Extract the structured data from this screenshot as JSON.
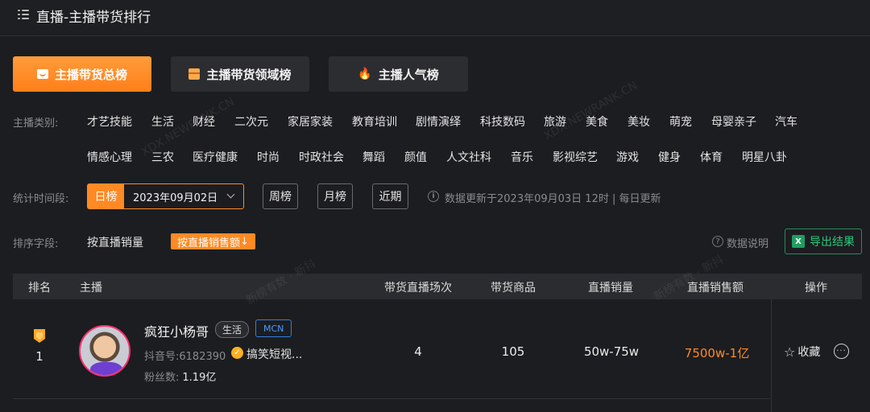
{
  "header": {
    "title": "直播-主播带货排行",
    "menu_icon": "menu-icon"
  },
  "tabs": [
    {
      "label": "主播带货总榜",
      "icon": "mail-icon",
      "active": true
    },
    {
      "label": "主播带货领域榜",
      "icon": "box-icon",
      "active": false
    },
    {
      "label": "主播人气榜",
      "icon": "fire-icon",
      "active": false
    }
  ],
  "filters": {
    "category_label": "主播类别:",
    "categories_row1": [
      "才艺技能",
      "生活",
      "财经",
      "二次元",
      "家居家装",
      "教育培训",
      "剧情演绎",
      "科技数码",
      "旅游",
      "美食",
      "美妆",
      "萌宠",
      "母婴亲子",
      "汽车"
    ],
    "categories_row2": [
      "情感心理",
      "三农",
      "医疗健康",
      "时尚",
      "时政社会",
      "舞蹈",
      "颜值",
      "人文社科",
      "音乐",
      "影视综艺",
      "游戏",
      "健身",
      "体育",
      "明星八卦"
    ],
    "period_label": "统计时间段:",
    "period_day": "日榜",
    "period_date": "2023年09月02日",
    "period_week": "周榜",
    "period_month": "月榜",
    "period_recent": "近期",
    "update_note": "数据更新于2023年09月03日 12时 | 每日更新",
    "sort_label": "排序字段:",
    "sort_options": [
      "按直播销量",
      "按直播销售额"
    ],
    "sort_active_arrow": "↓",
    "data_help": "数据说明",
    "export": "导出结果"
  },
  "table": {
    "columns": [
      "排名",
      "主播",
      "带货直播场次",
      "带货商品",
      "直播销量",
      "直播销售额",
      "操作"
    ],
    "rows": [
      {
        "rank": "1",
        "name": "疯狂小杨哥",
        "category_tag": "生活",
        "mcn_tag": "MCN",
        "douyin_id": "抖音号:6182390",
        "verify_text": "搞笑短视...",
        "fans_label": "粉丝数:",
        "fans_value": "1.19亿",
        "live_sessions": "4",
        "products": "105",
        "sales_volume": "50w-75w",
        "sales_amount": "7500w-1亿",
        "fav_label": "收藏",
        "more_label": "···"
      }
    ]
  },
  "watermark": {
    "url": "XDX.NEWRANK.CN",
    "brand": "新榜有数 · 新抖"
  },
  "colors": {
    "accent": "#ff8a24",
    "background": "#1c1d20",
    "export_green": "#28c97f",
    "mcn_blue": "#4d9bff"
  }
}
